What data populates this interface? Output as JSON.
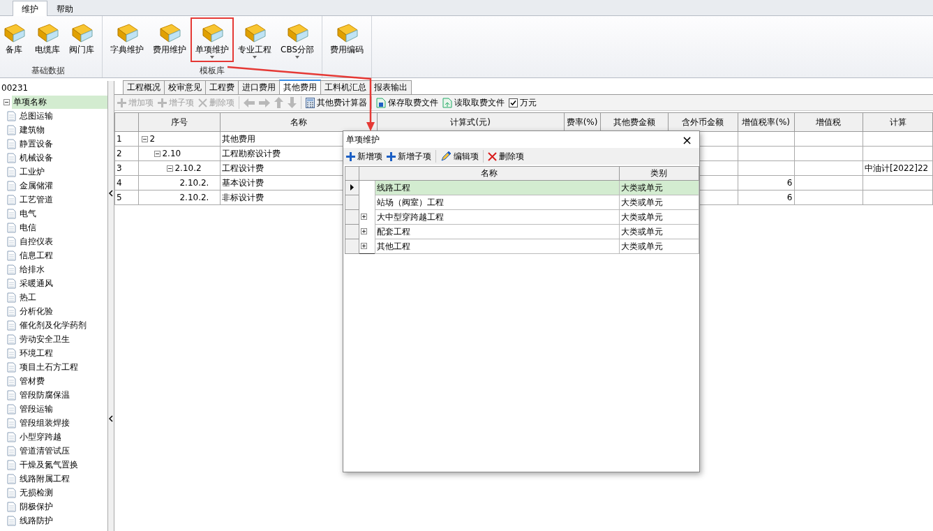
{
  "ribbon": {
    "tabs": [
      {
        "label": "维护",
        "selected": true
      },
      {
        "label": "帮助",
        "selected": false
      }
    ],
    "groups": [
      {
        "label": "基础数据",
        "buttons": [
          {
            "label": "备库",
            "dropdown": false
          },
          {
            "label": "电缆库",
            "dropdown": false
          },
          {
            "label": "阀门库",
            "dropdown": false
          }
        ]
      },
      {
        "label": "模板库",
        "buttons": [
          {
            "label": "字典维护",
            "dropdown": false
          },
          {
            "label": "费用维护",
            "dropdown": false
          },
          {
            "label": "单项维护",
            "dropdown": true
          },
          {
            "label": "专业工程",
            "dropdown": true
          },
          {
            "label": "CBS分部",
            "dropdown": true
          }
        ]
      },
      {
        "buttons": [
          {
            "label": "费用编码",
            "dropdown": false
          }
        ]
      }
    ]
  },
  "tree": [
    {
      "label": "00231",
      "selected": false,
      "children": [
        {
          "label": "单项名称",
          "expanded": true,
          "selected": true,
          "children": [
            {
              "label": "总图运输",
              "selected": false
            },
            {
              "label": "建筑物",
              "selected": false
            },
            {
              "label": "静置设备",
              "selected": false
            },
            {
              "label": "机械设备",
              "selected": false
            },
            {
              "label": "工业炉",
              "selected": false
            },
            {
              "label": "金属储灌",
              "selected": false
            },
            {
              "label": "工艺管道",
              "selected": false
            },
            {
              "label": "电气",
              "selected": false
            },
            {
              "label": "电信",
              "selected": false
            },
            {
              "label": "自控仪表",
              "selected": false
            },
            {
              "label": "信息工程",
              "selected": false
            },
            {
              "label": "给排水",
              "selected": false
            },
            {
              "label": "采暖通风",
              "selected": false
            },
            {
              "label": "热工",
              "selected": false
            },
            {
              "label": "分析化验",
              "selected": false
            },
            {
              "label": "催化剂及化学药剂",
              "selected": false
            },
            {
              "label": "劳动安全卫生",
              "selected": false
            },
            {
              "label": "环境工程",
              "selected": false
            },
            {
              "label": "项目土石方工程",
              "selected": false
            },
            {
              "label": "管材费",
              "selected": false
            },
            {
              "label": "管段防腐保温",
              "selected": false
            },
            {
              "label": "管段运输",
              "selected": false
            },
            {
              "label": "管段组装焊接",
              "selected": false
            },
            {
              "label": "小型穿跨越",
              "selected": false
            },
            {
              "label": "管道清管试压",
              "selected": false
            },
            {
              "label": "干燥及氮气置换",
              "selected": false
            },
            {
              "label": "线路附属工程",
              "selected": false
            },
            {
              "label": "无损检测",
              "selected": false
            },
            {
              "label": "阴极保护",
              "selected": false
            },
            {
              "label": "线路防护",
              "selected": false
            }
          ]
        }
      ]
    }
  ],
  "tabs": [
    {
      "label": "工程概况",
      "selected": false
    },
    {
      "label": "校审意见",
      "selected": false
    },
    {
      "label": "工程费",
      "selected": false
    },
    {
      "label": "进口费用",
      "selected": false
    },
    {
      "label": "其他费用",
      "selected": true
    },
    {
      "label": "工料机汇总",
      "selected": false
    },
    {
      "label": "报表输出",
      "selected": false
    }
  ],
  "toolbar": [
    {
      "kind": "button",
      "label": "增加项",
      "disabled": true
    },
    {
      "kind": "button",
      "label": "增子项",
      "disabled": true
    },
    {
      "kind": "button",
      "label": "删除项",
      "disabled": true
    },
    {
      "kind": "separator"
    },
    {
      "kind": "icon",
      "disabled": true
    },
    {
      "kind": "icon",
      "disabled": true
    },
    {
      "kind": "icon",
      "disabled": true
    },
    {
      "kind": "icon",
      "disabled": true
    },
    {
      "kind": "separator"
    },
    {
      "kind": "button",
      "label": "其他费计算器",
      "disabled": false
    },
    {
      "kind": "separator"
    },
    {
      "kind": "button",
      "label": "保存取费文件",
      "disabled": false
    },
    {
      "kind": "button",
      "label": "读取取费文件",
      "disabled": false
    },
    {
      "kind": "checkbox",
      "label": "万元",
      "checked": true
    }
  ],
  "table": {
    "columns": [
      "序号",
      "名称",
      "计算式(元)",
      "费率(%)",
      "其他费金额",
      "含外币金额",
      "增值税率(%)",
      "增值税",
      "计算"
    ],
    "rows": [
      {
        "no": "1",
        "code": "2",
        "name": "其他费用",
        "expanded": true,
        "cells": [
          "",
          "",
          "",
          "",
          "",
          ""
        ],
        "children": [
          {
            "no": "2",
            "code": "2.10",
            "name": "工程勘察设计费",
            "expanded": true,
            "cells": [
              "",
              "",
              "",
              "",
              "",
              ""
            ],
            "children": [
              {
                "no": "3",
                "code": "2.10.2",
                "name": "工程设计费",
                "expanded": true,
                "cells": [
                  "",
                  "",
                  "",
                  "",
                  "",
                  "中油计[2022]22"
                ],
                "children": [
                  {
                    "no": "4",
                    "code": "2.10.2.",
                    "name": "基本设计费",
                    "cells": [
                      "",
                      "",
                      "",
                      "6",
                      "",
                      ""
                    ]
                  },
                  {
                    "no": "5",
                    "code": "2.10.2.",
                    "name": "非标设计费",
                    "cells": [
                      "",
                      "",
                      "",
                      "6",
                      "",
                      ""
                    ]
                  }
                ]
              }
            ]
          }
        ]
      }
    ]
  },
  "dialog": {
    "title": "单项维护",
    "close": "×",
    "toolbar": [
      "新增项",
      "新增子项",
      "编辑项",
      "删除项"
    ],
    "columns": [
      "名称",
      "类别"
    ],
    "rows": [
      {
        "name": "线路工程",
        "category": "大类或单元",
        "selected": true
      },
      {
        "name": "站场（阀室）工程",
        "category": "大类或单元",
        "selected": false
      },
      {
        "name": "大中型穿跨越工程",
        "category": "大类或单元",
        "selected": false,
        "expanded": false
      },
      {
        "name": "配套工程",
        "category": "大类或单元",
        "selected": false,
        "expanded": false
      },
      {
        "name": "其他工程",
        "category": "大类或单元",
        "selected": false,
        "expanded": false
      }
    ]
  }
}
